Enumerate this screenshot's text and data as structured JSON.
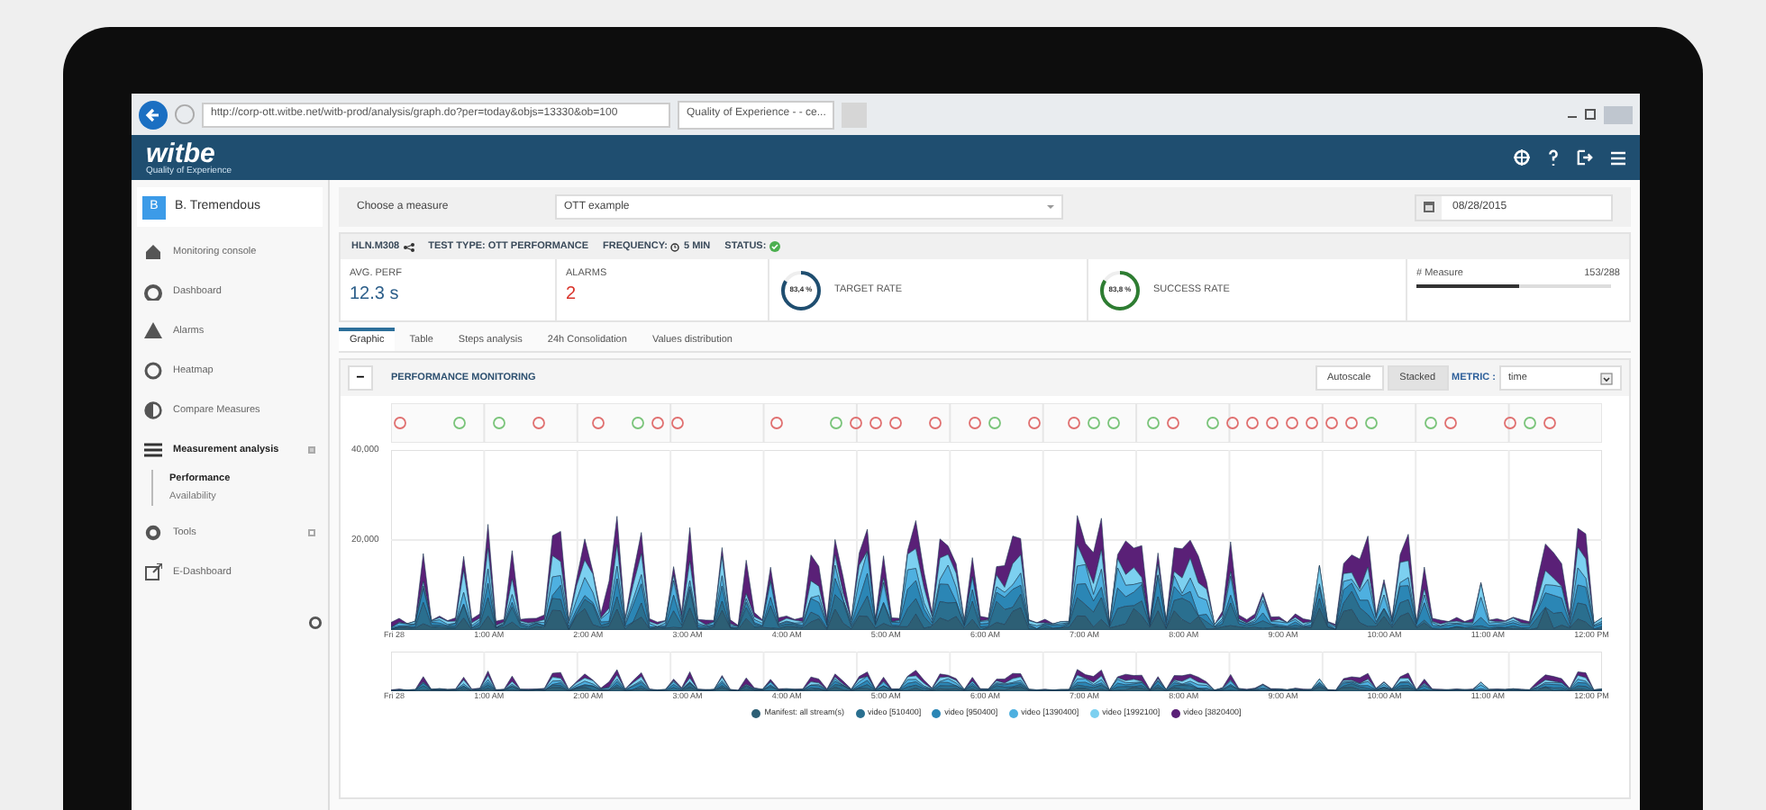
{
  "browser": {
    "url": "http://corp-ott.witbe.net/witb-prod/analysis/graph.do?per=today&objs=13330&ob=100",
    "tab_title": "Quality of Experience - - ce..."
  },
  "app": {
    "logo": "witbe",
    "tagline": "Quality of Experience"
  },
  "sidebar": {
    "user": {
      "initial": "B",
      "name": "B. Tremendous"
    },
    "items": [
      {
        "label": "Monitoring console",
        "selected": false
      },
      {
        "label": "Dashboard",
        "selected": false
      },
      {
        "label": "Alarms",
        "selected": false
      },
      {
        "label": "Heatmap",
        "selected": false
      },
      {
        "label": "Compare Measures",
        "selected": false
      },
      {
        "label": "Measurement analysis",
        "selected": true,
        "expanded": true,
        "children": [
          {
            "label": "Performance",
            "selected": true
          },
          {
            "label": "Availability",
            "selected": false
          }
        ]
      },
      {
        "label": "Tools",
        "selected": false,
        "expanded": false
      },
      {
        "label": "E-Dashboard",
        "selected": false
      }
    ]
  },
  "measure": {
    "label": "Choose a measure",
    "value": "OTT example",
    "date": "08/28/2015"
  },
  "info": {
    "id": "HLN.M308",
    "test_type": "TEST TYPE: OTT PERFORMANCE",
    "frequency": "FREQUENCY:",
    "frequency_value": "5 MIN",
    "status": "STATUS:"
  },
  "kpis": {
    "avg_perf": {
      "label": "AVG. PERF",
      "value": "12.3 s"
    },
    "alarms": {
      "label": "ALARMS",
      "value": "2"
    },
    "target_rate": {
      "label": "TARGET RATE",
      "reading": "83,4 %",
      "level": 0.834
    },
    "success_rate": {
      "label": "SUCCESS RATE",
      "reading": "83,8 %",
      "level": 0.838
    },
    "measure": {
      "label": "# Measure",
      "reading": "153/288",
      "level": 0.53
    }
  },
  "tabs": [
    {
      "label": "Graphic",
      "selected": true
    },
    {
      "label": "Table",
      "selected": false
    },
    {
      "label": "Steps analysis",
      "selected": false
    },
    {
      "label": "24h Consolidation",
      "selected": false
    },
    {
      "label": "Values distribution",
      "selected": false
    }
  ],
  "panel": {
    "collapse": "−",
    "title": "PERFORMANCE MONITORING",
    "buttons": [
      {
        "label": "Autoscale",
        "selected": false
      },
      {
        "label": "Stacked",
        "selected": true
      }
    ],
    "metric_label": "METRIC :",
    "metric": "time"
  },
  "chart": {
    "y_labels": [
      "40,000",
      "20,000"
    ],
    "x_labels": [
      "Fri 28",
      "1:00 AM",
      "2:00 AM",
      "3:00 AM",
      "4:00 AM",
      "5:00 AM",
      "6:00 AM",
      "7:00 AM",
      "8:00 AM",
      "9:00 AM",
      "10:00 AM",
      "11:00 AM",
      "12:00 PM"
    ],
    "nav_x_labels": [
      "Fri 28",
      "1:00 AM",
      "2:00 AM",
      "3:00 AM",
      "4:00 AM",
      "5:00 AM",
      "6:00 AM",
      "7:00 AM",
      "8:00 AM",
      "9:00 AM",
      "10:00 AM",
      "11:00 AM",
      "12:00 PM"
    ],
    "legend": [
      {
        "name": "Manifest: all stream(s)",
        "color": "#2d5f75"
      },
      {
        "name": "video [510400]",
        "color": "#2a6f8f"
      },
      {
        "name": "video [950400]",
        "color": "#2b86b5"
      },
      {
        "name": "video [1390400]",
        "color": "#4eb0e0"
      },
      {
        "name": "video [1992100]",
        "color": "#7cd0f0"
      },
      {
        "name": "video [3820400]",
        "color": "#5a2077"
      }
    ]
  }
}
